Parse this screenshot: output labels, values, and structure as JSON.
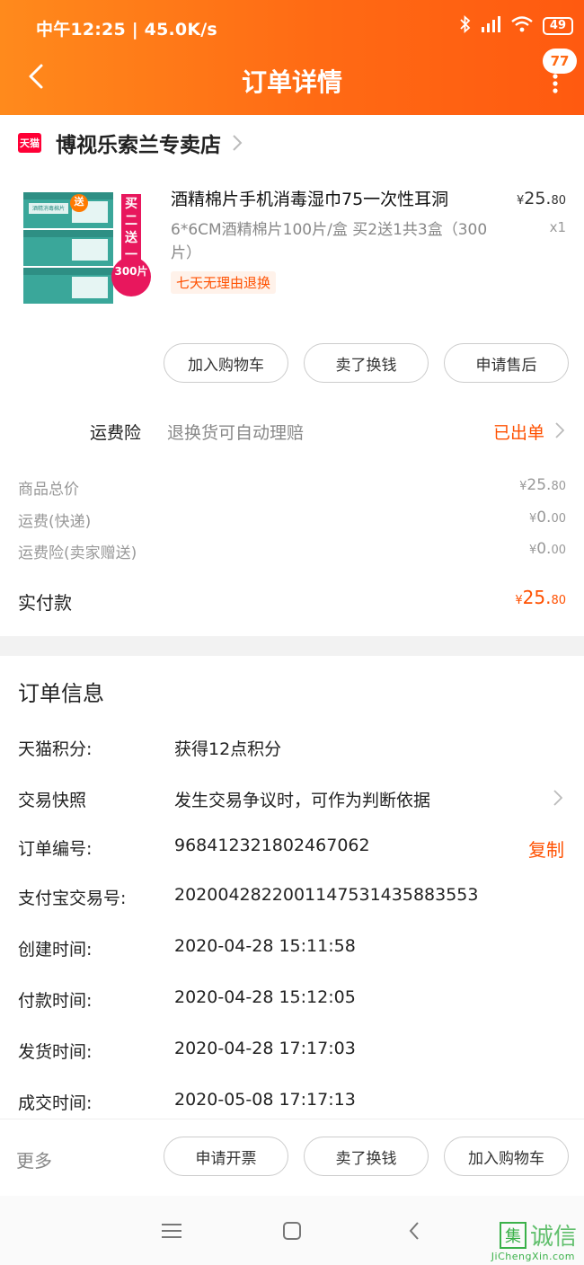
{
  "status_bar": {
    "left_text": "中午12:25 | 45.0K/s",
    "battery": "49"
  },
  "header": {
    "title": "订单详情",
    "badge_count": "77"
  },
  "shop": {
    "logo_text": "天猫",
    "name": "博视乐索兰专卖店"
  },
  "product": {
    "title": "酒精棉片手机消毒湿巾75一次性耳洞",
    "spec": "6*6CM酒精棉片100片/盒 买2送1共3盒（300片）",
    "tag": "七天无理由退换",
    "price_symbol": "¥",
    "price_int": "25.",
    "price_dec": "80",
    "qty": "x1",
    "image_texts": {
      "bundle": "买二送一",
      "count": "300片",
      "gift": "送",
      "box_label": "酒精消毒棉片"
    }
  },
  "actions": {
    "add_cart": "加入购物车",
    "sell": "卖了换钱",
    "after_sale": "申请售后"
  },
  "freight_insurance": {
    "label": "运费险",
    "desc": "退换货可自动理赔",
    "status": "已出单"
  },
  "costs": [
    {
      "label": "商品总价",
      "symbol": "¥",
      "int": "25.",
      "dec": "80"
    },
    {
      "label": "运费(快递)",
      "symbol": "¥",
      "int": "0.",
      "dec": "00"
    },
    {
      "label": "运费险(卖家赠送)",
      "symbol": "¥",
      "int": "0.",
      "dec": "00"
    }
  ],
  "paid": {
    "label": "实付款",
    "symbol": "¥",
    "int": "25.",
    "dec": "80"
  },
  "order_info": {
    "title": "订单信息",
    "rows": [
      {
        "label": "天猫积分:",
        "value": "获得12点积分"
      },
      {
        "label": "交易快照",
        "value": "发生交易争议时，可作为判断依据"
      },
      {
        "label": "订单编号:",
        "value": "968412321802467062"
      },
      {
        "label": "支付宝交易号:",
        "value": "2020042822001147531435883553"
      },
      {
        "label": "创建时间:",
        "value": "2020-04-28 15:11:58"
      },
      {
        "label": "付款时间:",
        "value": "2020-04-28 15:12:05"
      },
      {
        "label": "发货时间:",
        "value": "2020-04-28 17:17:03"
      },
      {
        "label": "成交时间:",
        "value": "2020-05-08 17:17:13"
      }
    ],
    "copy_label": "复制"
  },
  "bottom_bar": {
    "more": "更多",
    "invoice": "申请开票",
    "sell": "卖了换钱",
    "add_cart": "加入购物车"
  },
  "watermark": {
    "box": "集",
    "text": "诚信",
    "sub": "JiChengXin.com"
  }
}
